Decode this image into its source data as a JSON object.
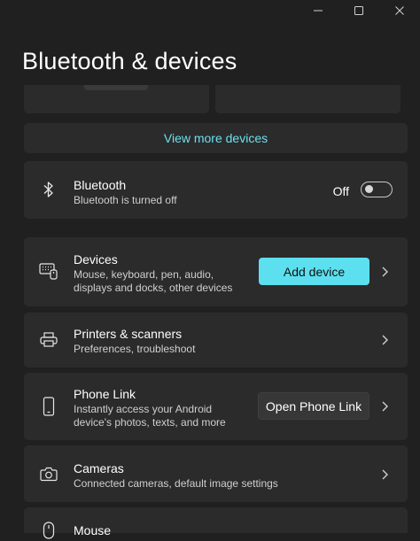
{
  "window": {
    "minimize": "minimize",
    "maximize": "maximize",
    "close": "close"
  },
  "page": {
    "title": "Bluetooth & devices"
  },
  "view_more": {
    "label": "View more devices"
  },
  "bluetooth": {
    "title": "Bluetooth",
    "desc": "Bluetooth is turned off",
    "state_label": "Off",
    "on": false
  },
  "devices": {
    "title": "Devices",
    "desc_line1": "Mouse, keyboard, pen, audio,",
    "desc_line2": "displays and docks, other devices",
    "button": "Add device"
  },
  "printers": {
    "title": "Printers & scanners",
    "desc": "Preferences, troubleshoot"
  },
  "phone_link": {
    "title": "Phone Link",
    "desc_line1": "Instantly access your Android",
    "desc_line2": "device's photos, texts, and more",
    "button": "Open Phone Link"
  },
  "cameras": {
    "title": "Cameras",
    "desc": "Connected cameras, default image settings"
  },
  "mouse": {
    "title": "Mouse"
  },
  "colors": {
    "accent": "#5ce0ef",
    "link": "#6ce0ee",
    "background": "#202020",
    "card": "#2b2b2b"
  },
  "icons": [
    "minimize-icon",
    "maximize-icon",
    "close-icon",
    "bluetooth-icon",
    "devices-icon",
    "printer-icon",
    "phone-icon",
    "camera-icon",
    "mouse-icon",
    "chevron-right-icon"
  ]
}
